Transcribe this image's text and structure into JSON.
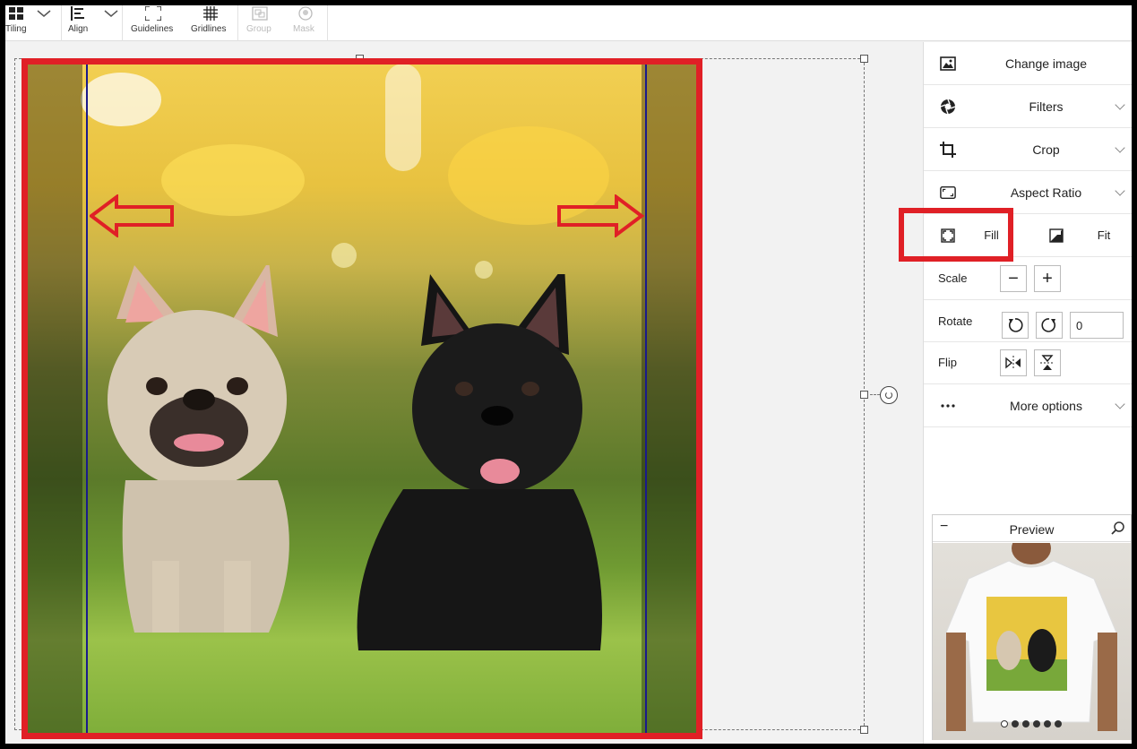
{
  "toolbar": {
    "items": [
      {
        "label": "Tiling",
        "enabled": true
      },
      {
        "label": "Align",
        "enabled": true
      },
      {
        "label": "Guidelines",
        "enabled": true
      },
      {
        "label": "Gridlines",
        "enabled": true
      },
      {
        "label": "Group",
        "enabled": false
      },
      {
        "label": "Mask",
        "enabled": false
      }
    ]
  },
  "panel": {
    "change_image": "Change image",
    "filters": "Filters",
    "crop": "Crop",
    "aspect_ratio": "Aspect Ratio",
    "fill": "Fill",
    "fit": "Fit",
    "scale": "Scale",
    "rotate": "Rotate",
    "rotate_value": "0",
    "flip": "Flip",
    "more_options": "More options",
    "selected_mode": "Fill"
  },
  "preview": {
    "title": "Preview",
    "page_count": 6,
    "active_page": 1
  },
  "colors": {
    "highlight": "#e02026",
    "guide_line": "#1a1a8c"
  }
}
